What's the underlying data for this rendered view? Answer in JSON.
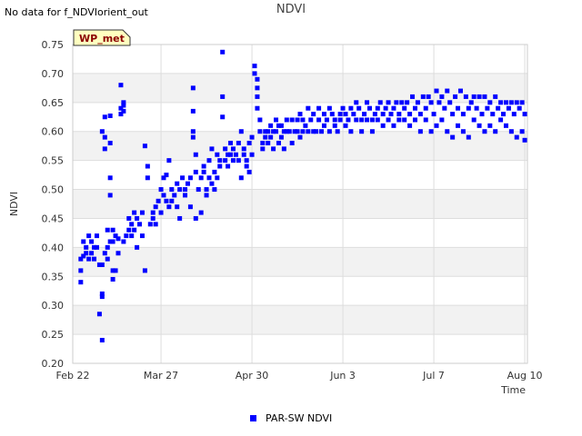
{
  "header": {
    "no_data_text": "No data for f_NDVIorient_out",
    "title": "NDVI"
  },
  "chart_data": {
    "type": "scatter",
    "title": "NDVI",
    "xlabel": "Time",
    "ylabel": "NDVI",
    "badge": "WP_met",
    "xlim": [
      0,
      170
    ],
    "ylim": [
      0.2,
      0.75
    ],
    "x_ticks": [
      {
        "label": "Feb 22",
        "day": 0
      },
      {
        "label": "Mar 27",
        "day": 33
      },
      {
        "label": "Apr 30",
        "day": 67
      },
      {
        "label": "Jun 3",
        "day": 101
      },
      {
        "label": "Jul 7",
        "day": 135
      },
      {
        "label": "Aug 10",
        "day": 169
      }
    ],
    "y_ticks": [
      0.2,
      0.25,
      0.3,
      0.35,
      0.4,
      0.45,
      0.5,
      0.55,
      0.6,
      0.65,
      0.7,
      0.75
    ],
    "grid": true,
    "legend_position": "bottom",
    "series": [
      {
        "name": "PAR-SW NDVI",
        "color": "#0000ff",
        "points": [
          [
            3,
            0.34
          ],
          [
            3,
            0.36
          ],
          [
            3,
            0.38
          ],
          [
            4,
            0.385
          ],
          [
            4,
            0.41
          ],
          [
            5,
            0.39
          ],
          [
            5,
            0.4
          ],
          [
            6,
            0.38
          ],
          [
            6,
            0.42
          ],
          [
            7,
            0.39
          ],
          [
            7,
            0.41
          ],
          [
            8,
            0.4
          ],
          [
            8,
            0.38
          ],
          [
            9,
            0.4
          ],
          [
            9,
            0.42
          ],
          [
            10,
            0.37
          ],
          [
            10,
            0.285
          ],
          [
            11,
            0.32
          ],
          [
            11,
            0.315
          ],
          [
            11,
            0.24
          ],
          [
            11,
            0.37
          ],
          [
            11,
            0.6
          ],
          [
            12,
            0.59
          ],
          [
            12,
            0.57
          ],
          [
            12,
            0.625
          ],
          [
            12,
            0.39
          ],
          [
            13,
            0.43
          ],
          [
            13,
            0.4
          ],
          [
            13,
            0.38
          ],
          [
            14,
            0.41
          ],
          [
            14,
            0.49
          ],
          [
            14,
            0.52
          ],
          [
            14,
            0.58
          ],
          [
            14,
            0.627
          ],
          [
            15,
            0.345
          ],
          [
            15,
            0.36
          ],
          [
            15,
            0.43
          ],
          [
            15,
            0.41
          ],
          [
            16,
            0.42
          ],
          [
            16,
            0.36
          ],
          [
            17,
            0.415
          ],
          [
            17,
            0.39
          ],
          [
            18,
            0.68
          ],
          [
            18,
            0.64
          ],
          [
            18,
            0.63
          ],
          [
            19,
            0.65
          ],
          [
            19,
            0.645
          ],
          [
            19,
            0.635
          ],
          [
            19,
            0.41
          ],
          [
            20,
            0.42
          ],
          [
            21,
            0.43
          ],
          [
            21,
            0.45
          ],
          [
            22,
            0.42
          ],
          [
            22,
            0.44
          ],
          [
            23,
            0.46
          ],
          [
            23,
            0.43
          ],
          [
            24,
            0.4
          ],
          [
            24,
            0.45
          ],
          [
            25,
            0.44
          ],
          [
            26,
            0.42
          ],
          [
            26,
            0.46
          ],
          [
            27,
            0.36
          ],
          [
            27,
            0.575
          ],
          [
            28,
            0.54
          ],
          [
            28,
            0.52
          ],
          [
            29,
            0.44
          ],
          [
            30,
            0.45
          ],
          [
            30,
            0.46
          ],
          [
            31,
            0.47
          ],
          [
            31,
            0.44
          ],
          [
            32,
            0.48
          ],
          [
            33,
            0.46
          ],
          [
            33,
            0.5
          ],
          [
            34,
            0.49
          ],
          [
            34,
            0.52
          ],
          [
            35,
            0.48
          ],
          [
            35,
            0.525
          ],
          [
            36,
            0.47
          ],
          [
            36,
            0.55
          ],
          [
            37,
            0.5
          ],
          [
            37,
            0.48
          ],
          [
            38,
            0.49
          ],
          [
            39,
            0.51
          ],
          [
            39,
            0.47
          ],
          [
            40,
            0.5
          ],
          [
            40,
            0.45
          ],
          [
            41,
            0.52
          ],
          [
            42,
            0.5
          ],
          [
            42,
            0.49
          ],
          [
            43,
            0.51
          ],
          [
            44,
            0.52
          ],
          [
            44,
            0.47
          ],
          [
            45,
            0.675
          ],
          [
            45,
            0.635
          ],
          [
            45,
            0.59
          ],
          [
            45,
            0.6
          ],
          [
            46,
            0.53
          ],
          [
            46,
            0.56
          ],
          [
            46,
            0.45
          ],
          [
            47,
            0.5
          ],
          [
            48,
            0.52
          ],
          [
            48,
            0.46
          ],
          [
            49,
            0.54
          ],
          [
            49,
            0.53
          ],
          [
            50,
            0.5
          ],
          [
            50,
            0.49
          ],
          [
            51,
            0.55
          ],
          [
            51,
            0.52
          ],
          [
            52,
            0.51
          ],
          [
            52,
            0.57
          ],
          [
            53,
            0.53
          ],
          [
            53,
            0.5
          ],
          [
            54,
            0.52
          ],
          [
            54,
            0.56
          ],
          [
            55,
            0.54
          ],
          [
            55,
            0.55
          ],
          [
            56,
            0.66
          ],
          [
            56,
            0.625
          ],
          [
            56,
            0.737
          ],
          [
            57,
            0.57
          ],
          [
            57,
            0.55
          ],
          [
            58,
            0.56
          ],
          [
            58,
            0.54
          ],
          [
            59,
            0.56
          ],
          [
            59,
            0.58
          ],
          [
            60,
            0.55
          ],
          [
            60,
            0.57
          ],
          [
            61,
            0.56
          ],
          [
            62,
            0.58
          ],
          [
            62,
            0.55
          ],
          [
            63,
            0.6
          ],
          [
            63,
            0.52
          ],
          [
            64,
            0.56
          ],
          [
            64,
            0.57
          ],
          [
            65,
            0.55
          ],
          [
            65,
            0.54
          ],
          [
            66,
            0.58
          ],
          [
            66,
            0.53
          ],
          [
            67,
            0.59
          ],
          [
            67,
            0.56
          ],
          [
            68,
            0.713
          ],
          [
            68,
            0.7
          ],
          [
            69,
            0.69
          ],
          [
            69,
            0.675
          ],
          [
            69,
            0.66
          ],
          [
            69,
            0.64
          ],
          [
            70,
            0.62
          ],
          [
            70,
            0.6
          ],
          [
            71,
            0.58
          ],
          [
            71,
            0.57
          ],
          [
            72,
            0.6
          ],
          [
            72,
            0.59
          ],
          [
            73,
            0.58
          ],
          [
            73,
            0.6
          ],
          [
            74,
            0.61
          ],
          [
            74,
            0.59
          ],
          [
            75,
            0.57
          ],
          [
            75,
            0.6
          ],
          [
            76,
            0.6
          ],
          [
            76,
            0.62
          ],
          [
            77,
            0.58
          ],
          [
            77,
            0.61
          ],
          [
            78,
            0.61
          ],
          [
            78,
            0.59
          ],
          [
            79,
            0.6
          ],
          [
            79,
            0.57
          ],
          [
            80,
            0.62
          ],
          [
            80,
            0.6
          ],
          [
            81,
            0.6
          ],
          [
            82,
            0.58
          ],
          [
            82,
            0.62
          ],
          [
            83,
            0.6
          ],
          [
            84,
            0.62
          ],
          [
            84,
            0.6
          ],
          [
            85,
            0.59
          ],
          [
            85,
            0.63
          ],
          [
            86,
            0.6
          ],
          [
            86,
            0.62
          ],
          [
            87,
            0.61
          ],
          [
            88,
            0.6
          ],
          [
            88,
            0.64
          ],
          [
            89,
            0.62
          ],
          [
            90,
            0.6
          ],
          [
            90,
            0.63
          ],
          [
            91,
            0.6
          ],
          [
            92,
            0.62
          ],
          [
            92,
            0.64
          ],
          [
            93,
            0.6
          ],
          [
            94,
            0.63
          ],
          [
            94,
            0.61
          ],
          [
            95,
            0.62
          ],
          [
            96,
            0.64
          ],
          [
            96,
            0.6
          ],
          [
            97,
            0.63
          ],
          [
            98,
            0.62
          ],
          [
            98,
            0.61
          ],
          [
            99,
            0.6
          ],
          [
            100,
            0.63
          ],
          [
            100,
            0.62
          ],
          [
            101,
            0.64
          ],
          [
            102,
            0.61
          ],
          [
            102,
            0.63
          ],
          [
            103,
            0.62
          ],
          [
            104,
            0.64
          ],
          [
            104,
            0.6
          ],
          [
            105,
            0.63
          ],
          [
            106,
            0.62
          ],
          [
            106,
            0.65
          ],
          [
            107,
            0.64
          ],
          [
            108,
            0.62
          ],
          [
            108,
            0.6
          ],
          [
            109,
            0.63
          ],
          [
            110,
            0.65
          ],
          [
            110,
            0.62
          ],
          [
            111,
            0.64
          ],
          [
            112,
            0.62
          ],
          [
            112,
            0.6
          ],
          [
            113,
            0.63
          ],
          [
            114,
            0.64
          ],
          [
            114,
            0.62
          ],
          [
            115,
            0.65
          ],
          [
            116,
            0.63
          ],
          [
            116,
            0.61
          ],
          [
            117,
            0.64
          ],
          [
            118,
            0.65
          ],
          [
            118,
            0.62
          ],
          [
            119,
            0.63
          ],
          [
            120,
            0.64
          ],
          [
            120,
            0.61
          ],
          [
            121,
            0.65
          ],
          [
            122,
            0.63
          ],
          [
            122,
            0.62
          ],
          [
            123,
            0.65
          ],
          [
            124,
            0.64
          ],
          [
            124,
            0.62
          ],
          [
            125,
            0.65
          ],
          [
            126,
            0.63
          ],
          [
            126,
            0.61
          ],
          [
            127,
            0.66
          ],
          [
            128,
            0.64
          ],
          [
            128,
            0.62
          ],
          [
            129,
            0.65
          ],
          [
            130,
            0.63
          ],
          [
            130,
            0.6
          ],
          [
            131,
            0.66
          ],
          [
            132,
            0.64
          ],
          [
            132,
            0.62
          ],
          [
            133,
            0.66
          ],
          [
            134,
            0.65
          ],
          [
            134,
            0.6
          ],
          [
            135,
            0.63
          ],
          [
            136,
            0.67
          ],
          [
            136,
            0.61
          ],
          [
            137,
            0.65
          ],
          [
            138,
            0.66
          ],
          [
            138,
            0.62
          ],
          [
            139,
            0.64
          ],
          [
            140,
            0.67
          ],
          [
            140,
            0.6
          ],
          [
            141,
            0.65
          ],
          [
            142,
            0.63
          ],
          [
            142,
            0.59
          ],
          [
            143,
            0.66
          ],
          [
            144,
            0.64
          ],
          [
            144,
            0.61
          ],
          [
            145,
            0.67
          ],
          [
            146,
            0.63
          ],
          [
            146,
            0.6
          ],
          [
            147,
            0.66
          ],
          [
            148,
            0.64
          ],
          [
            148,
            0.59
          ],
          [
            149,
            0.65
          ],
          [
            150,
            0.66
          ],
          [
            150,
            0.62
          ],
          [
            151,
            0.64
          ],
          [
            152,
            0.66
          ],
          [
            152,
            0.61
          ],
          [
            153,
            0.63
          ],
          [
            154,
            0.66
          ],
          [
            154,
            0.6
          ],
          [
            155,
            0.64
          ],
          [
            156,
            0.65
          ],
          [
            156,
            0.61
          ],
          [
            157,
            0.63
          ],
          [
            158,
            0.66
          ],
          [
            158,
            0.6
          ],
          [
            159,
            0.64
          ],
          [
            160,
            0.65
          ],
          [
            160,
            0.62
          ],
          [
            161,
            0.63
          ],
          [
            162,
            0.65
          ],
          [
            162,
            0.61
          ],
          [
            163,
            0.64
          ],
          [
            164,
            0.65
          ],
          [
            164,
            0.6
          ],
          [
            165,
            0.63
          ],
          [
            166,
            0.65
          ],
          [
            166,
            0.59
          ],
          [
            167,
            0.64
          ],
          [
            168,
            0.65
          ],
          [
            168,
            0.6
          ],
          [
            169,
            0.63
          ],
          [
            169,
            0.585
          ]
        ]
      }
    ]
  }
}
